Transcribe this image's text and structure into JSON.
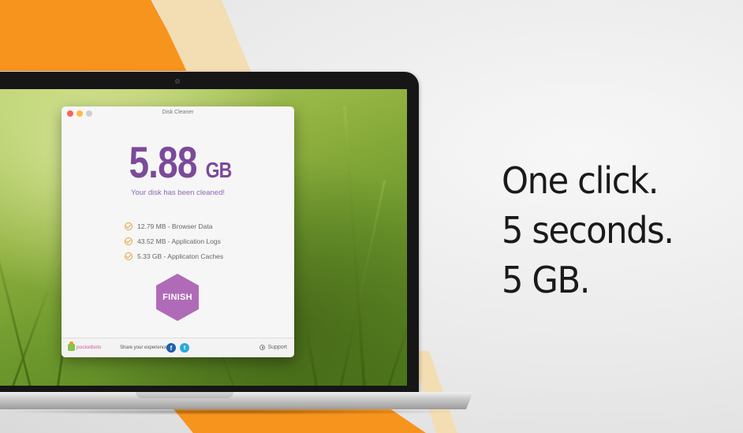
{
  "app": {
    "window_title": "Disk Cleaner",
    "result": {
      "amount": "5.88",
      "unit": "GB"
    },
    "status_message": "Your disk has been cleaned!",
    "cleaned_items": [
      {
        "label": "12.79 MB - Browser Data"
      },
      {
        "label": "43.52 MB - Application Logs"
      },
      {
        "label": "5.33 GB - Applicaton Caches"
      }
    ],
    "finish_label": "FINISH",
    "footer": {
      "logo_text": "pocketbots",
      "share_label": "Share your experience",
      "facebook_glyph": "f",
      "twitter_glyph": "t",
      "support_label": "Support"
    }
  },
  "tagline": [
    "One click.",
    "5 seconds.",
    "5 GB."
  ],
  "colors": {
    "accent_purple": "#7b4a9a",
    "finish_button": "#b06bb8",
    "orange_stripe": "#f7941d",
    "check_color": "#e5a23a"
  }
}
